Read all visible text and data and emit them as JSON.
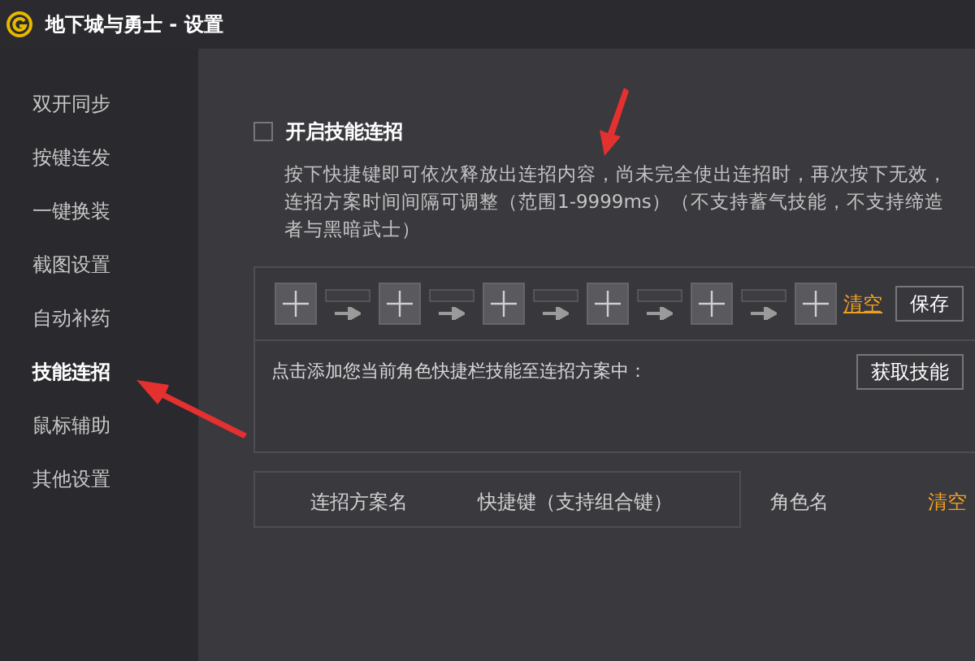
{
  "window": {
    "title": "地下城与勇士 - 设置"
  },
  "sidebar": {
    "items": [
      {
        "label": "双开同步",
        "selected": false
      },
      {
        "label": "按键连发",
        "selected": false
      },
      {
        "label": "一键换装",
        "selected": false
      },
      {
        "label": "截图设置",
        "selected": false
      },
      {
        "label": "自动补药",
        "selected": false
      },
      {
        "label": "技能连招",
        "selected": true
      },
      {
        "label": "鼠标辅助",
        "selected": false
      },
      {
        "label": "其他设置",
        "selected": false
      }
    ]
  },
  "combo": {
    "enable": {
      "label": "开启技能连招",
      "checked": false
    },
    "description": "按下快捷键即可依次释放出连招内容，尚未完全使出连招时，再次按下无效，连招方案时间间隔可调整（范围1-9999ms）（不支持蓄气技能，不支持缔造者与黑暗武士）",
    "slots": [
      {
        "filled": false
      },
      {
        "filled": false
      },
      {
        "filled": false
      },
      {
        "filled": false
      },
      {
        "filled": false
      },
      {
        "filled": false
      }
    ],
    "clear_link": "清空",
    "save_button": "保存",
    "hint": "点击添加您当前角色快捷栏技能至连招方案中：",
    "fetch_button": "获取技能"
  },
  "table": {
    "columns": [
      {
        "label": "连招方案名",
        "kind": "text"
      },
      {
        "label": "快捷键（支持组合键）",
        "kind": "text"
      },
      {
        "label": "角色名",
        "kind": "text"
      },
      {
        "label": "清空",
        "kind": "link"
      }
    ]
  }
}
